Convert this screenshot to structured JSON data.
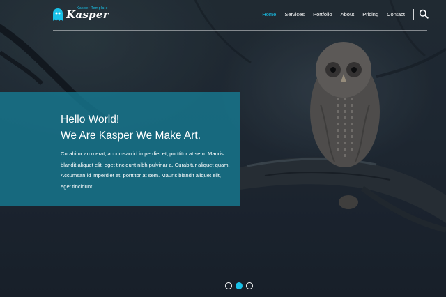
{
  "brand": {
    "name": "Kasper",
    "tagline": "Kasper Template",
    "accent": "#19c1e8"
  },
  "nav": {
    "items": [
      {
        "label": "Home",
        "active": true
      },
      {
        "label": "Services",
        "active": false
      },
      {
        "label": "Portfolio",
        "active": false
      },
      {
        "label": "About",
        "active": false
      },
      {
        "label": "Pricing",
        "active": false
      },
      {
        "label": "Contact",
        "active": false
      }
    ],
    "search_icon": "search-icon"
  },
  "hero": {
    "heading_line1": "Hello World!",
    "heading_line2": "We Are Kasper We Make Art.",
    "paragraph": "Curabitur arcu erat, accumsan id imperdiet et, porttitor at sem. Mauris blandit aliquet elit, eget tincidunt nibh pulvinar a. Curabitur aliquet quam. Accumsan id imperdiet et, porttitor at sem. Mauris blandit aliquet elit, eget tincidunt.",
    "box_color": "#167a92"
  },
  "slider": {
    "count": 3,
    "active_index": 1
  }
}
